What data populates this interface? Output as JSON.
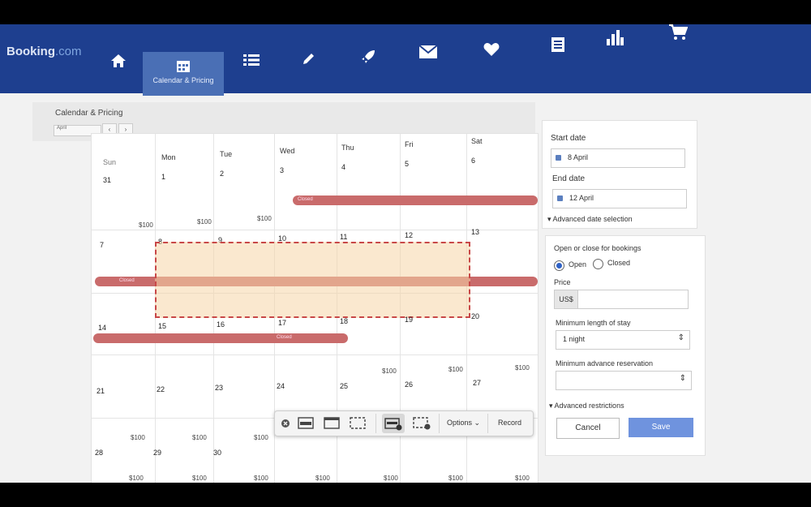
{
  "app": {
    "logo_main": "Booking",
    "logo_suffix": ".com"
  },
  "nav": {
    "items": [
      {
        "name": "home-icon",
        "label": ""
      },
      {
        "name": "calendar-icon",
        "label": "Calendar & Pricing"
      },
      {
        "name": "list-icon",
        "label": ""
      },
      {
        "name": "pencil-icon",
        "label": ""
      },
      {
        "name": "rocket-icon",
        "label": ""
      },
      {
        "name": "mail-icon",
        "label": ""
      },
      {
        "name": "heart-icon",
        "label": ""
      },
      {
        "name": "document-icon",
        "label": ""
      },
      {
        "name": "bar-chart-icon",
        "label": ""
      },
      {
        "name": "cart-icon",
        "label": ""
      }
    ]
  },
  "subheader": {
    "title": "Calendar & Pricing",
    "month_value": "April",
    "prev_label": "‹",
    "next_label": "›"
  },
  "calendar": {
    "days": [
      "Sun",
      "Mon",
      "Tue",
      "Wed",
      "Thu",
      "Fri",
      "Sat"
    ],
    "weeks": [
      [
        "31",
        "1",
        "2",
        "3",
        "4",
        "5",
        "6"
      ],
      [
        "7",
        "8",
        "9",
        "10",
        "11",
        "12",
        "13"
      ],
      [
        "14",
        "15",
        "16",
        "17",
        "18",
        "19",
        "20"
      ],
      [
        "21",
        "22",
        "23",
        "24",
        "25",
        "26",
        "27"
      ],
      [
        "28",
        "29",
        "30",
        "",
        "",
        "",
        ""
      ]
    ],
    "price": "$100",
    "closed_label": "Closed"
  },
  "dates_panel": {
    "start_label": "Start date",
    "start_value": "8 April",
    "end_label": "End date",
    "end_value": "12 April",
    "advanced_label": "Advanced date selection"
  },
  "booking_panel": {
    "open_close_label": "Open or close for bookings",
    "open_label": "Open",
    "closed_label": "Closed",
    "price_label": "Price",
    "currency": "US$",
    "price_value": "",
    "min_stay_label": "Minimum length of stay",
    "min_stay_value": "1 night",
    "min_advance_label": "Minimum advance reservation",
    "min_advance_value": "",
    "advanced_restrictions_label": "Advanced restrictions",
    "cancel_label": "Cancel",
    "save_label": "Save"
  },
  "capture_toolbar": {
    "options_label": "Options",
    "record_label": "Record"
  },
  "colors": {
    "brand": "#1e3f8f",
    "closed_bar": "#c96b6b",
    "save_button": "#6f93de"
  }
}
